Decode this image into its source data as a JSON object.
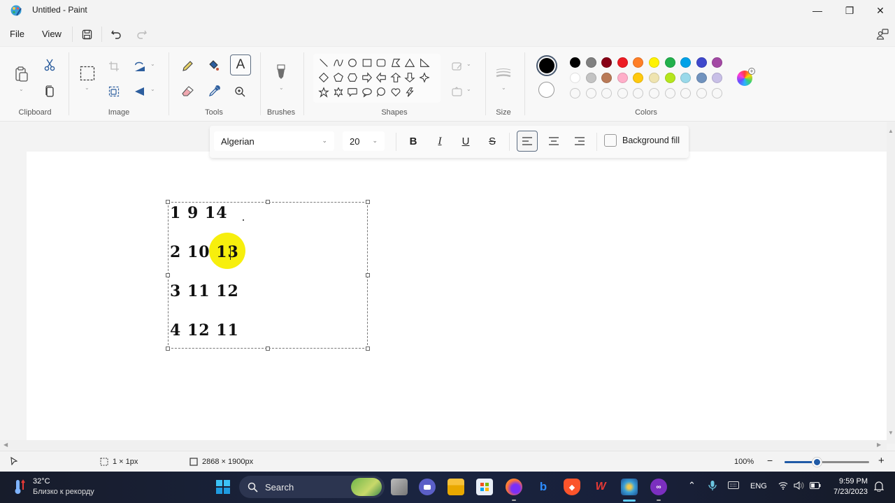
{
  "window": {
    "title": "Untitled - Paint",
    "controls": {
      "minimize": "—",
      "maximize": "❐",
      "close": "✕"
    }
  },
  "menu": {
    "items": [
      "File",
      "View"
    ],
    "quick_access": [
      "save-icon",
      "undo-icon",
      "redo-icon"
    ],
    "share_icon": "share-icon"
  },
  "ribbon": {
    "groups": {
      "clipboard": "Clipboard",
      "image": "Image",
      "tools": "Tools",
      "brushes": "Brushes",
      "shapes": "Shapes",
      "size": "Size",
      "colors": "Colors"
    },
    "text_tool_glyph": "A",
    "shapes": [
      "line",
      "curve",
      "oval",
      "rectangle",
      "rounded-rectangle",
      "polygon",
      "triangle",
      "right-triangle",
      "diamond",
      "pentagon",
      "hexagon",
      "right-arrow",
      "left-arrow",
      "up-arrow",
      "down-arrow",
      "four-point-star",
      "five-point-star",
      "six-point-star",
      "rounded-callout",
      "oval-callout",
      "cloud-callout",
      "heart",
      "lightning"
    ],
    "colors": {
      "primary": "#000000",
      "secondary": "#ffffff",
      "row1": [
        "#000000",
        "#808080",
        "#880015",
        "#ed1c24",
        "#ff7f27",
        "#fff200",
        "#22b14c",
        "#00a2e8",
        "#3f48cc",
        "#a349a4"
      ],
      "row2": [
        "#ffffff",
        "#c3c3c3",
        "#b97a57",
        "#ffaec9",
        "#ffc90e",
        "#efe4b0",
        "#b5e61d",
        "#99d9ea",
        "#7092be",
        "#c8bfe7"
      ],
      "row3_empty_count": 10
    }
  },
  "text_toolbar": {
    "font": "Algerian",
    "size": "20",
    "bold": "B",
    "italic": "I",
    "underline": "U",
    "strikethrough": "S",
    "align_active": "left",
    "background_fill_label": "Background fill",
    "background_fill_checked": false
  },
  "canvas": {
    "text_lines": [
      "1 9 14",
      "2 10 13",
      "3 11 12",
      "4 12 11"
    ]
  },
  "statusbar": {
    "selection_size": "1 × 1px",
    "canvas_size": "2868 × 1900px",
    "zoom": "100%",
    "zoom_minus": "−",
    "zoom_plus": "+",
    "zoom_fraction": 0.38
  },
  "taskbar": {
    "weather_temp": "32°C",
    "weather_text": "Близко к рекорду",
    "search_label": "Search",
    "apps": [
      "task-view",
      "teams-meet",
      "file-explorer",
      "microsoft-store",
      "firefox",
      "bing",
      "brave",
      "wps-office",
      "paint",
      "clipchamp"
    ],
    "lang": "ENG",
    "time": "9:59 PM",
    "date": "7/23/2023"
  }
}
